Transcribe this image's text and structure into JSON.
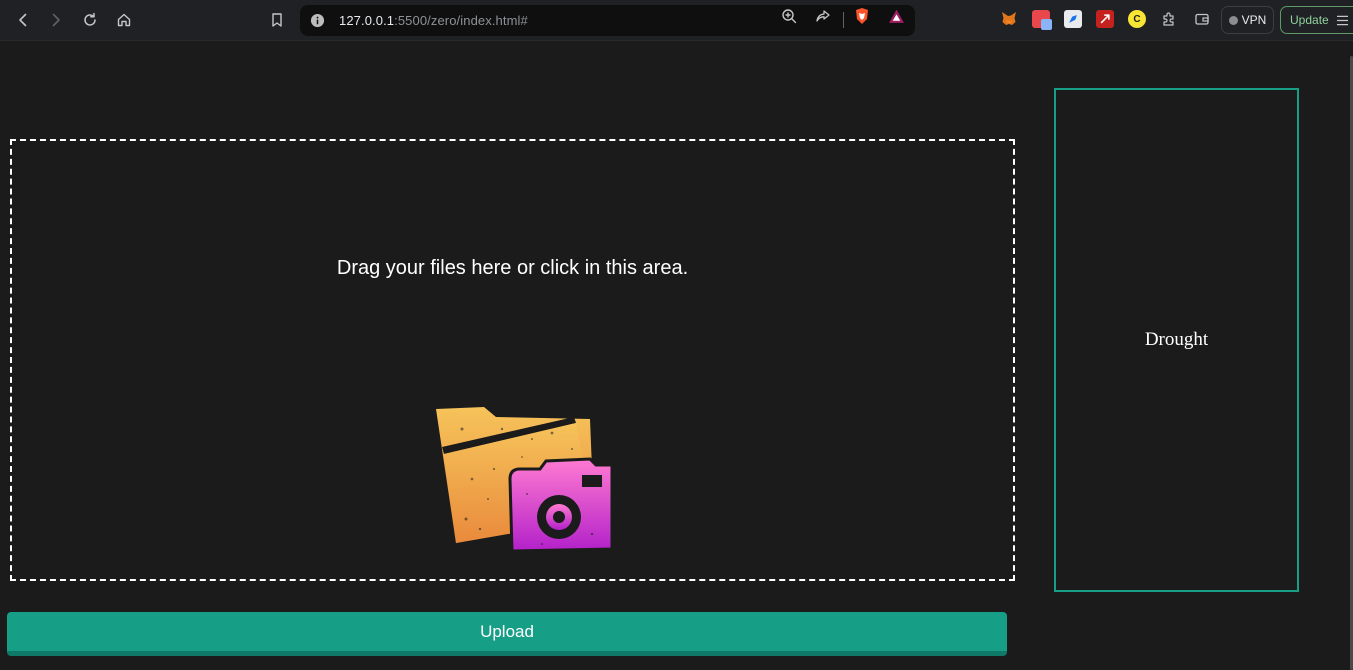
{
  "browser": {
    "url_host": "127.0.0.1",
    "url_rest": ":5500/zero/index.html#",
    "vpn_label": "VPN",
    "update_label": "Update",
    "icons": [
      "back-icon",
      "forward-icon",
      "reload-icon",
      "home-icon",
      "bookmark-icon",
      "site-info-icon",
      "zoom-icon",
      "share-icon",
      "brave-shields-icon",
      "brave-rewards-icon",
      "metamask-extension-icon",
      "extension-icon",
      "extension-icon",
      "extension-icon",
      "coin-extension-icon",
      "extensions-puzzle-icon",
      "wallet-icon",
      "menu-icon"
    ]
  },
  "page": {
    "dropzone_text": "Drag your files here or click in this area.",
    "upload_label": "Upload",
    "result_label": "Drought"
  },
  "colors": {
    "accent": "#179e87",
    "background": "#1b1b1b",
    "toolbar": "#202124"
  }
}
